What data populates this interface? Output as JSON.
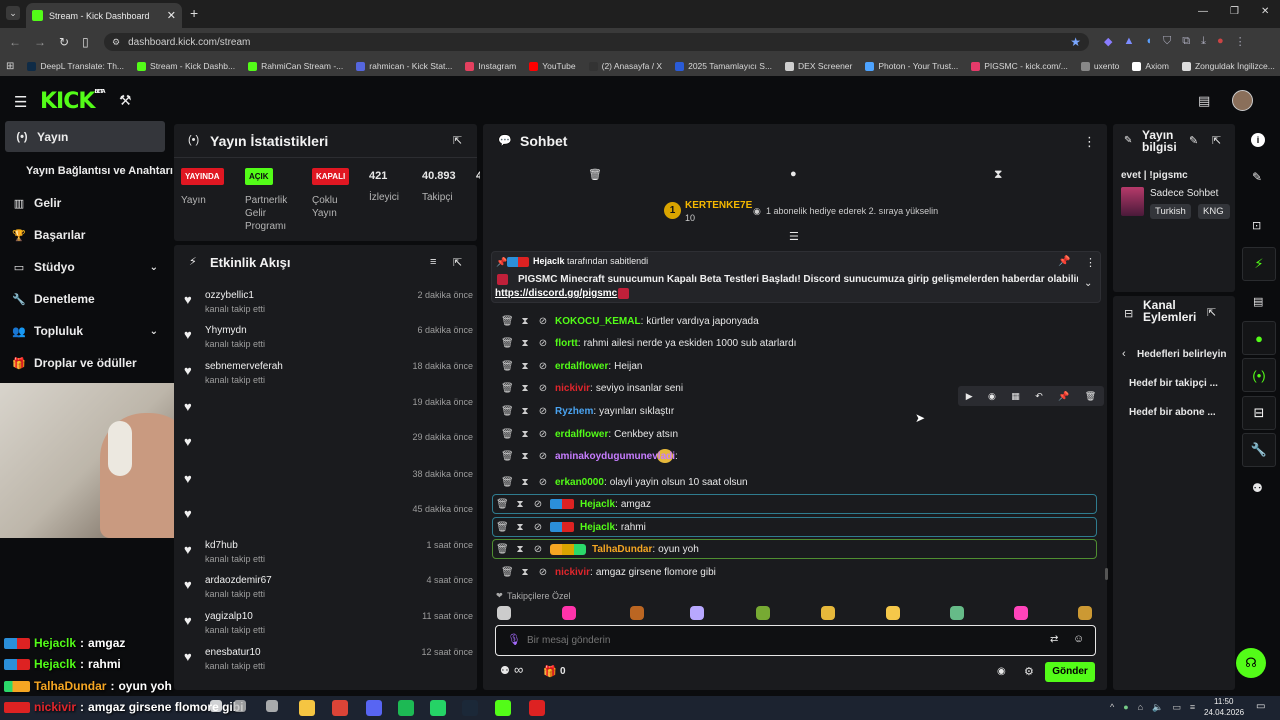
{
  "browser": {
    "tab_title": "Stream - Kick Dashboard",
    "url": "dashboard.kick.com/stream",
    "bookmarks": [
      "DeepL Translate: Th...",
      "Stream - Kick Dashb...",
      "RahmiCan Stream -...",
      "rahmican - Kick Stat...",
      "Instagram",
      "YouTube",
      "(2) Anasayfa / X",
      "2025 Tamamlayıcı S...",
      "DEX Screener",
      "Photon - Your Trust...",
      "PIGSMC - kick.com/...",
      "uxento",
      "Axiom",
      "Zonguldak İngilizce..."
    ]
  },
  "header": {
    "logo": "KICK",
    "beta": "BETA"
  },
  "sidebar": {
    "items": [
      {
        "label": "Yayın",
        "icon": "broadcast-icon",
        "active": true
      },
      {
        "label": "Yayın Bağlantısı ve Anahtarı"
      },
      {
        "label": "Gelir",
        "icon": "bank-icon"
      },
      {
        "label": "Başarılar",
        "icon": "trophy-icon"
      },
      {
        "label": "Stüdyo",
        "icon": "tv-icon",
        "chevron": true
      },
      {
        "label": "Denetleme",
        "icon": "wrench-icon"
      },
      {
        "label": "Topluluk",
        "icon": "community-icon",
        "chevron": true
      },
      {
        "label": "Droplar ve ödüller",
        "icon": "gift-icon"
      }
    ]
  },
  "stats": {
    "title": "Yayın İstatistikleri",
    "badges": [
      {
        "text": "YAYINDA",
        "label": "Yayın",
        "color": "#e01722"
      },
      {
        "text": "AÇIK",
        "label": "Partnerlik Gelir Programı",
        "color": "#53fc18"
      },
      {
        "text": "KAPALI",
        "label": "Çoklu Yayın",
        "color": "#e01722"
      }
    ],
    "viewers": {
      "value": "421",
      "label": "İzleyici"
    },
    "followers": {
      "value": "40.893",
      "label": "Takipçi"
    },
    "truncated": "4"
  },
  "activity": {
    "title": "Etkinlik Akışı",
    "items": [
      {
        "name": "ozzybellic1",
        "sub": "kanalı takip etti",
        "time": "2 dakika önce"
      },
      {
        "name": "Yhymydn",
        "sub": "kanalı takip etti",
        "time": "6 dakika önce"
      },
      {
        "name": "sebnemerveferah",
        "sub": "kanalı takip etti",
        "time": "18 dakika önce"
      },
      {
        "name": "",
        "sub": "",
        "time": "19 dakika önce"
      },
      {
        "name": "",
        "sub": "",
        "time": "29 dakika önce"
      },
      {
        "name": "",
        "sub": "",
        "time": "38 dakika önce"
      },
      {
        "name": "",
        "sub": "",
        "time": "45 dakika önce"
      },
      {
        "name": "kd7hub",
        "sub": "kanalı takip etti",
        "time": "1 saat önce"
      },
      {
        "name": "ardaozdemir67",
        "sub": "kanalı takip etti",
        "time": "4 saat önce"
      },
      {
        "name": "yagizalp10",
        "sub": "kanalı takip etti",
        "time": "11 saat önce"
      },
      {
        "name": "enesbatur10",
        "sub": "kanalı takip etti",
        "time": "12 saat önce"
      }
    ]
  },
  "chat": {
    "title": "Sohbet",
    "top_gifter": {
      "name": "KERTENKE7E",
      "count": "10",
      "rank": "1"
    },
    "gift_note": "1 abonelik hediye ederek 2. sıraya yükselin",
    "pinned": {
      "by": "Hejaclk",
      "by_suffix": "tarafından sabitlendi",
      "text": "PIGSMC Minecraft sunucumun Kapalı Beta Testleri Başladı! Discord sunucumuza girip gelişmelerden haberdar olabilirsiniz:",
      "link": "https://discord.gg/pigsmc"
    },
    "messages": [
      {
        "user": "KOKOCU_KEMAL",
        "color": "#53fc18",
        "text": "kürtler vardıya japonyada"
      },
      {
        "user": "flortt",
        "color": "#53fc18",
        "text": "rahmi ailesi nerde ya eskiden 1000 sub atarlardı"
      },
      {
        "user": "erdalflower",
        "color": "#53fc18",
        "text": "Heijan"
      },
      {
        "user": "nickivir",
        "color": "#e0262c",
        "text": "seviyo insanlar seni"
      },
      {
        "user": "Ryzhem",
        "color": "#4aa3f0",
        "text": "yayınları sıklaştır"
      },
      {
        "user": "erdalflower",
        "color": "#53fc18",
        "text": "Cenkbey atsın"
      },
      {
        "user": "aminakoydugumunevladi",
        "color": "#c77dff",
        "text": ""
      },
      {
        "user": "erkan0000",
        "color": "#53fc18",
        "text": "olayli yayin olsun 10 saat olsun"
      },
      {
        "user": "Hejaclk",
        "color": "#53fc18",
        "text": "amgaz"
      },
      {
        "user": "Hejaclk",
        "color": "#53fc18",
        "text": "rahmi"
      },
      {
        "user": "TalhaDundar",
        "color": "#f5a623",
        "text": "oyun yoh"
      },
      {
        "user": "nickivir",
        "color": "#e0262c",
        "text": "amgaz girsene flomore gibi"
      }
    ],
    "emote_label": "Takipçilere Özel",
    "input_placeholder": "Bir mesaj gönderin",
    "send_label": "Gönder",
    "points": "0",
    "infinity": "∞"
  },
  "stream_info": {
    "title": "Yayın bilgisi",
    "stream_title": "evet | !pigsmc",
    "category": "Sadece Sohbet",
    "tags": [
      "Turkish",
      "KNG"
    ]
  },
  "channel_actions": {
    "title": "Kanal Eylemleri",
    "items": [
      "Hedefleri belirleyin",
      "Hedef bir takipçi ...",
      "Hedef bir abone ..."
    ]
  },
  "overlay": {
    "lines": [
      {
        "user": "Hejaclk",
        "text": "amgaz"
      },
      {
        "user": "Hejaclk",
        "text": "rahmi"
      },
      {
        "user": "TalhaDundar",
        "text": "oyun yoh"
      },
      {
        "user": "nickivir",
        "text": "amgaz girsene flomore gibi"
      }
    ]
  },
  "taskbar": {
    "time": "11:50",
    "date": "24.04.2026"
  }
}
